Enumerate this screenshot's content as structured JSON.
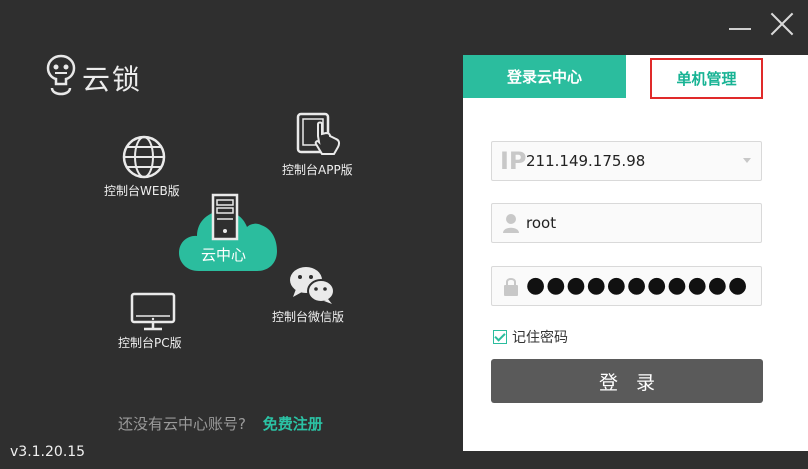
{
  "app": {
    "logo_text": "云锁",
    "version": "v3.1.20.15"
  },
  "diagram": {
    "cloud_label": "云中心",
    "nodes": {
      "web": "控制台WEB版",
      "app": "控制台APP版",
      "pc": "控制台PC版",
      "wechat": "控制台微信版"
    }
  },
  "signup": {
    "question": "还没有云中心账号?",
    "link": "免费注册"
  },
  "tabs": {
    "cloud_login": "登录云中心",
    "standalone": "单机管理"
  },
  "form": {
    "ip_prefix": "IP",
    "ip_value": "211.149.175.98",
    "username": "root",
    "password_mask": "●●●●●●●●●●●",
    "remember_label": "记住密码",
    "remember_checked": true,
    "login_label": "登录"
  },
  "colors": {
    "accent": "#2bbd9e",
    "highlight_box": "#e02a2a",
    "background": "#2f2f2f"
  }
}
